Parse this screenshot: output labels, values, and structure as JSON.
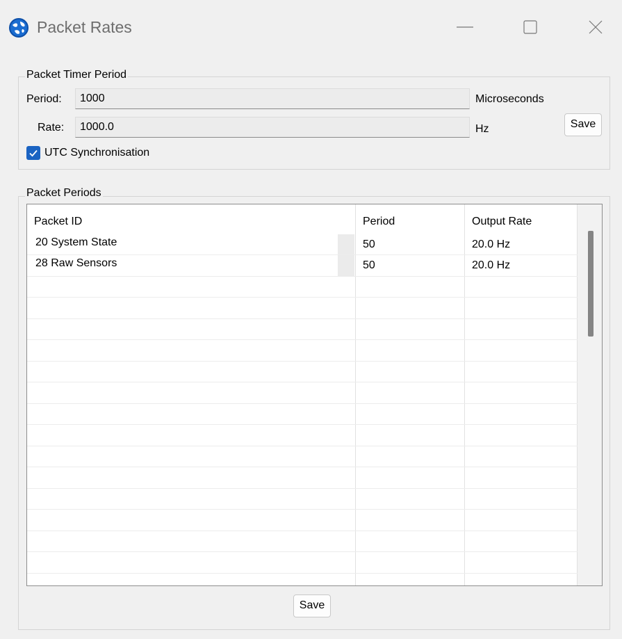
{
  "window": {
    "title": "Packet Rates",
    "icon": "app-globe-icon",
    "controls": [
      "minimize-icon",
      "maximize-icon",
      "close-icon"
    ]
  },
  "timer_group": {
    "title": "Packet Timer Period",
    "period_label": "Period:",
    "period_value": "1000",
    "period_unit": "Microseconds",
    "rate_label": "Rate:",
    "rate_value": "1000.0",
    "rate_unit": "Hz",
    "save_label": "Save",
    "utc_label": "UTC Synchronisation",
    "utc_checked": true
  },
  "periods_group": {
    "title": "Packet Periods",
    "columns": [
      "Packet ID",
      "Period",
      "Output Rate"
    ],
    "rows": [
      {
        "id": "20 System State",
        "period": "50",
        "rate": "20.0 Hz"
      },
      {
        "id": "28 Raw Sensors",
        "period": "50",
        "rate": "20.0 Hz"
      }
    ],
    "save_label": "Save"
  },
  "colors": {
    "accent": "#1a63c2",
    "background": "#f0f0f0",
    "border": "#d4d4d4"
  }
}
